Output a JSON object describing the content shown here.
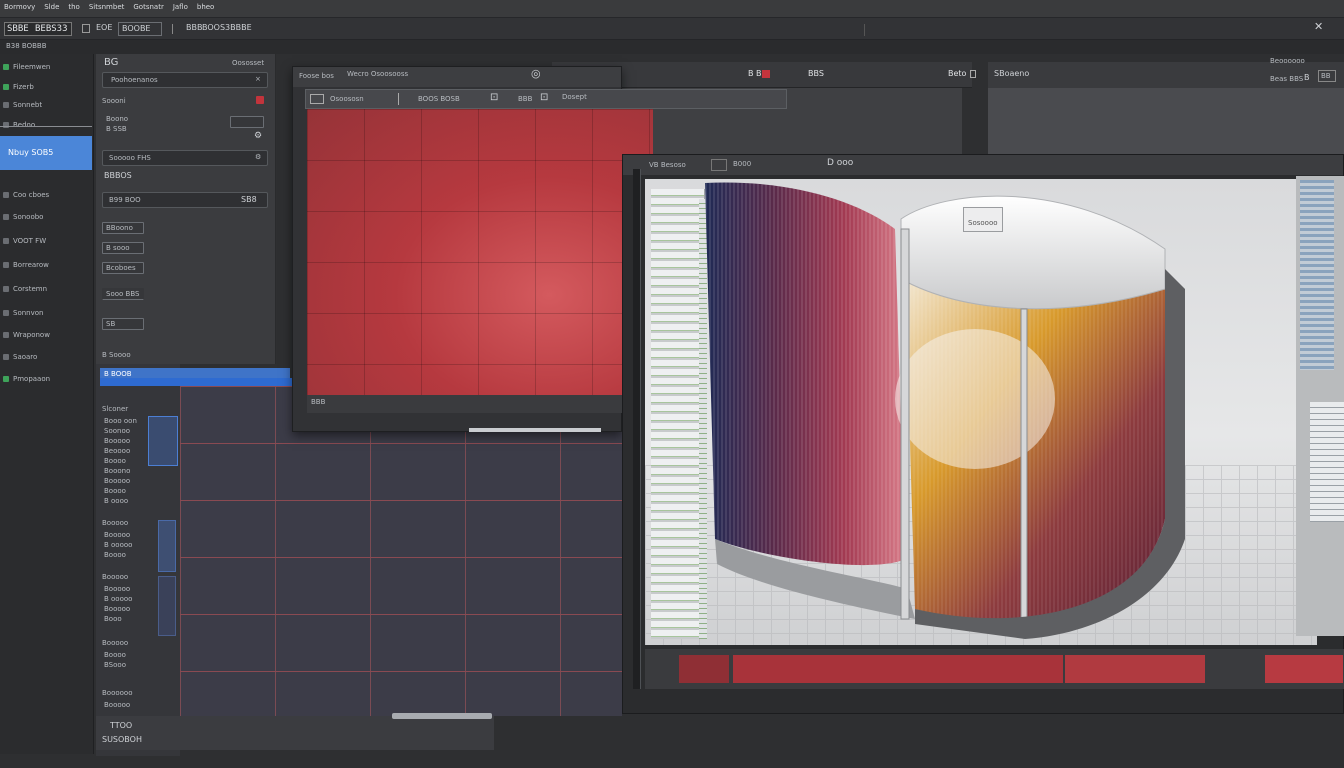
{
  "menubar": {
    "items": [
      "Bormovy",
      "Slde",
      "tho",
      "Sitsnmbet",
      "Gotsnatr",
      "Jaflo",
      "bheo"
    ]
  },
  "toolbar": {
    "doc_label": "SBBE",
    "doc_value": "BEBS33",
    "field_label": "EOE",
    "field_value": "BOOBE",
    "mode_label": "BBB",
    "mode_value": "BOOS3BBBE"
  },
  "subbar": {
    "label": "B38 BOBBB"
  },
  "sidebar": {
    "items": [
      {
        "label": "Fileemwen",
        "style": "green"
      },
      {
        "label": "Fizerb",
        "style": "green"
      },
      {
        "label": "Sonnebt",
        "style": "normal"
      },
      {
        "label": "Bedoo",
        "style": "normal"
      },
      {
        "label": "Nbuy SOB5",
        "style": "active"
      },
      {
        "label": "Coo cboes",
        "style": "normal"
      },
      {
        "label": "Sonoobo",
        "style": "normal"
      },
      {
        "label": "VOOT FW",
        "style": "normal"
      },
      {
        "label": "Borrearow",
        "style": "normal"
      },
      {
        "label": "Corstemn",
        "style": "normal"
      },
      {
        "label": "Sonnvon",
        "style": "normal"
      },
      {
        "label": "Wraponow",
        "style": "normal"
      },
      {
        "label": "Saoaro",
        "style": "normal"
      },
      {
        "label": "Pmopaaon",
        "style": "green"
      }
    ]
  },
  "props": {
    "header_left": "BG",
    "header_right": "Oososset",
    "title_field": "Poohoenanos",
    "label1": "Soooni",
    "sub1": "Boono",
    "sub2": "B SSB",
    "field2": "Sooooo FHS",
    "value2": "BBBOS",
    "field3": "B99 BOO",
    "value3": "SB8",
    "box1": "BBoono",
    "box2": "B sooo",
    "box3": "Bcoboes",
    "box4": "Sooo BBS",
    "box5": "SB",
    "box6": "B Soooo",
    "footer": "B BOOB"
  },
  "list": {
    "items": [
      "Slconer",
      "Booo oon",
      "Soonoo",
      "Booooo",
      "Beoooo",
      "Boooo",
      "Booono",
      "Booooo",
      "Boooo",
      "B oooo",
      "Booooo",
      "Booooo",
      "B ooooo",
      "Boooo",
      "Booooo",
      "Booooo",
      "B ooooo",
      "Booooo",
      "Booo",
      "Booooo",
      "Boooo",
      "BSooo",
      "Boooooo",
      "Booooo"
    ],
    "bottom_top": "TTOO",
    "bottom_label": "SUSOBOH"
  },
  "red_window": {
    "title": "Foose bos",
    "title2": "Wecro Osoosooss",
    "tool_a": "Osoososn",
    "tool_b": "BOOS BOSB",
    "tool_c": "BBB",
    "tool_d": "Dosept",
    "status": "BBB"
  },
  "right_top": {
    "label1": "B B",
    "label2": "BBS",
    "label3": "Beto",
    "label4": "SBoaeno",
    "label5": "Beoooooo",
    "label6": "Beas BBS",
    "label7": "B",
    "label8": "BB"
  },
  "view_window": {
    "title": "VB Besoso",
    "field": "B000",
    "label": "D ooo",
    "overlay_label": "Sosoooo"
  },
  "colors": {
    "accent": "#4b86d8",
    "red": "#b6363f",
    "panel": "#3b3c3f",
    "bg": "#2e2f31"
  }
}
